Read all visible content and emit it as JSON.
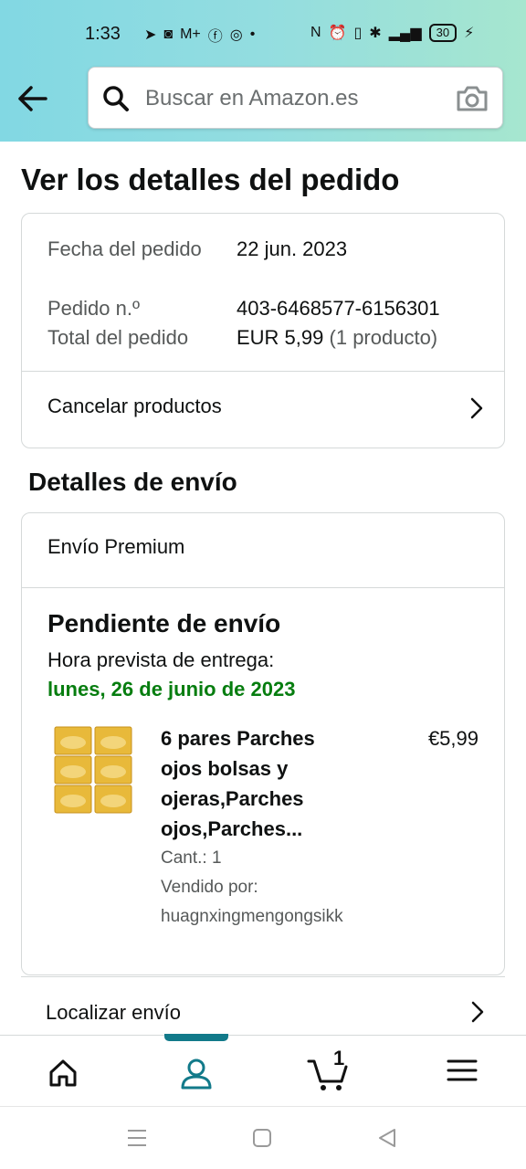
{
  "status_bar": {
    "time": "1:33",
    "battery": "30"
  },
  "search": {
    "placeholder": "Buscar en Amazon.es"
  },
  "page": {
    "title": "Ver los detalles del pedido"
  },
  "order_summary": {
    "date_label": "Fecha del pedido",
    "date_value": "22 jun. 2023",
    "number_label": "Pedido n.º",
    "number_value": "403-6468577-6156301",
    "total_label": "Total del pedido",
    "total_value": "EUR 5,99",
    "total_count": "(1 producto)",
    "cancel_link": "Cancelar productos"
  },
  "shipping": {
    "section_title": "Detalles de envío",
    "type": "Envío Premium",
    "status": "Pendiente de envío",
    "eta_label": "Hora prevista de entrega:",
    "eta_date": "lunes, 26 de junio de 2023",
    "product": {
      "title_lines": [
        "6 pares Parches",
        "ojos bolsas y",
        "ojeras,Parches",
        "ojos,Parches..."
      ],
      "price": "€5,99",
      "quantity": "Cant.: 1",
      "seller_label": "Vendido por:",
      "seller": "huagnxingmengongsikk"
    },
    "track_link": "Localizar envío"
  },
  "bottom_nav": {
    "cart_count": "1",
    "accent": "#127a8a"
  }
}
